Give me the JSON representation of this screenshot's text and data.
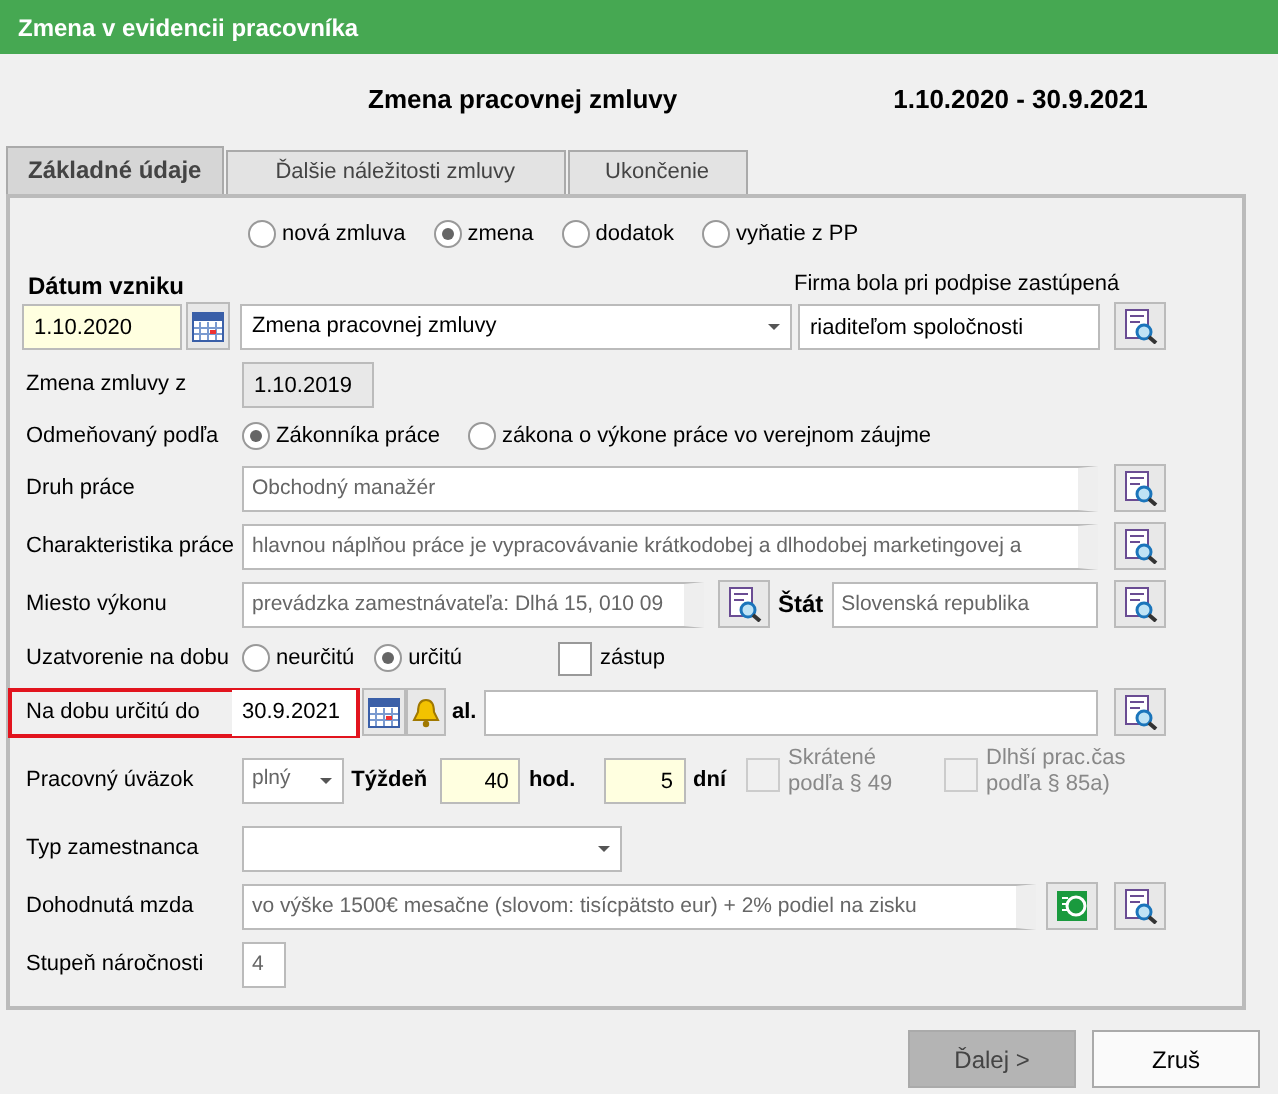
{
  "window": {
    "title": "Zmena v evidencii pracovníka"
  },
  "header": {
    "title": "Zmena pracovnej zmluvy",
    "period": "1.10.2020 - 30.9.2021"
  },
  "tabs": [
    {
      "label": "Základné údaje",
      "selected": true
    },
    {
      "label": "Ďalšie náležitosti zmluvy",
      "selected": false
    },
    {
      "label": "Ukončenie",
      "selected": false
    }
  ],
  "contract_kind": [
    {
      "label": "nová zmluva",
      "selected": false
    },
    {
      "label": "zmena",
      "selected": true
    },
    {
      "label": "dodatok",
      "selected": false
    },
    {
      "label": "vyňatie z PP",
      "selected": false
    }
  ],
  "origin": {
    "label": "Dátum vzniku",
    "date": "1.10.2020",
    "type_value": "Zmena pracovnej zmluvy",
    "represented_label": "Firma bola pri podpise zastúpená",
    "represented_value": "riaditeľom spoločnosti"
  },
  "changed_from": {
    "label": "Zmena zmluvy z",
    "value": "1.10.2019"
  },
  "paid_by": {
    "label": "Odmeňovaný podľa",
    "options": [
      {
        "label": "Zákonníka práce",
        "selected": true
      },
      {
        "label": "zákona o výkone práce vo verejnom záujme",
        "selected": false
      }
    ]
  },
  "job_type": {
    "label": "Druh práce",
    "value": "Obchodný manažér"
  },
  "job_description": {
    "label": "Charakteristika práce",
    "value": "hlavnou náplňou práce je vypracovávanie krátkodobej a dlhodobej marketingovej a"
  },
  "workplace": {
    "label": "Miesto výkonu",
    "value": "prevádzka zamestnávateľa: Dlhá 15, 010 09",
    "country_label": "Štát",
    "country_value": "Slovenská republika"
  },
  "term": {
    "label": "Uzatvorenie na dobu",
    "options": [
      {
        "label": "neurčitú",
        "selected": false
      },
      {
        "label": "určitú",
        "selected": true
      }
    ],
    "substitute": {
      "label": "zástup",
      "checked": false
    }
  },
  "fixed_until": {
    "label": "Na dobu určitú do",
    "value": "30.9.2021",
    "highlighted": true,
    "alt_label": "al."
  },
  "workload": {
    "label": "Pracovný úväzok",
    "value": "plný",
    "week_label": "Týždeň",
    "hours": "40",
    "hours_unit": "hod.",
    "days": "5",
    "days_unit": "dní",
    "options": [
      {
        "label": "Skrátené podľa § 49",
        "checked": false,
        "disabled": true
      },
      {
        "label": "Dlhší prac.čas podľa § 85a)",
        "checked": false,
        "disabled": true
      }
    ]
  },
  "employee_type": {
    "label": "Typ zamestnanca"
  },
  "wage": {
    "label": "Dohodnutá mzda",
    "value": "vo výške 1500€ mesačne (slovom: tisícpätsto eur) + 2% podiel na zisku"
  },
  "difficulty": {
    "label": "Stupeň náročnosti",
    "value": "4"
  },
  "buttons": [
    {
      "label": "Ďalej >",
      "disabled": true
    },
    {
      "label": "Zruš",
      "disabled": false
    }
  ]
}
